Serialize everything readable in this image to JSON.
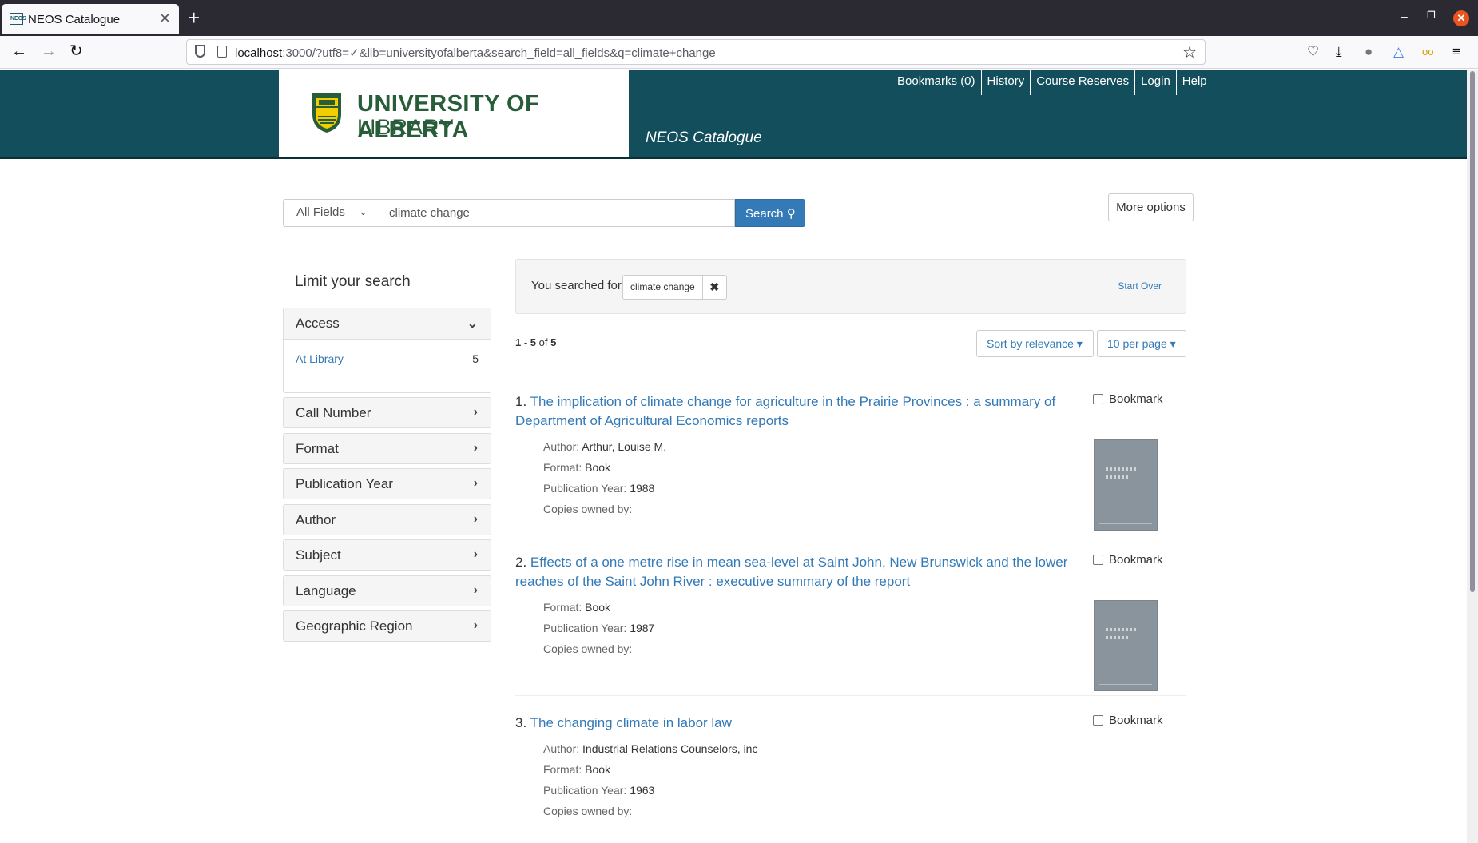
{
  "browser": {
    "tab_title": "NEOS Catalogue",
    "favicon_text": "NEOS",
    "url_host": "localhost",
    "url_rest": ":3000/?utf8=✓&lib=universityofalberta&search_field=all_fields&q=climate+change"
  },
  "header": {
    "logo_line1": "UNIVERSITY OF ALBERTA",
    "logo_line2": "LIBRARY",
    "catalogue_name": "NEOS Catalogue",
    "nav": [
      "Bookmarks (0)",
      "History",
      "Course Reserves",
      "Login",
      "Help"
    ]
  },
  "search": {
    "field": "All Fields",
    "query": "climate change",
    "button": "Search",
    "more_options": "More options"
  },
  "sidebar": {
    "title": "Limit your search",
    "access": {
      "label": "Access",
      "item": "At Library",
      "count": "5"
    },
    "facets": [
      "Call Number",
      "Format",
      "Publication Year",
      "Author",
      "Subject",
      "Language",
      "Geographic Region"
    ]
  },
  "constraints": {
    "label": "You searched for:",
    "value": "climate change",
    "start_over": "Start Over"
  },
  "results": {
    "range_start": "1",
    "range_end": "5",
    "of": "of",
    "total": "5",
    "sort": "Sort by relevance ▾",
    "per_page": "10 per page ▾",
    "bookmark_label": "Bookmark",
    "docs": [
      {
        "num": "1.",
        "title": "The implication of climate change for agriculture in the Prairie Provinces : a summary of Department of Agricultural Economics reports",
        "author": "Arthur, Louise M.",
        "format": "Book",
        "year": "1988"
      },
      {
        "num": "2.",
        "title": "Effects of a one metre rise in mean sea-level at Saint John, New Brunswick and the lower reaches of the Saint John River : executive summary of the report",
        "format": "Book",
        "year": "1987"
      },
      {
        "num": "3.",
        "title": "The changing climate in labor law",
        "author": "Industrial Relations Counselors, inc",
        "format": "Book",
        "year": "1963"
      }
    ]
  },
  "labels": {
    "author": "Author:",
    "format": "Format:",
    "year": "Publication Year:",
    "copies": "Copies owned by:"
  },
  "colors": {
    "header_bg": "#124e5b",
    "brand_green": "#275d38",
    "link": "#337ab7"
  }
}
